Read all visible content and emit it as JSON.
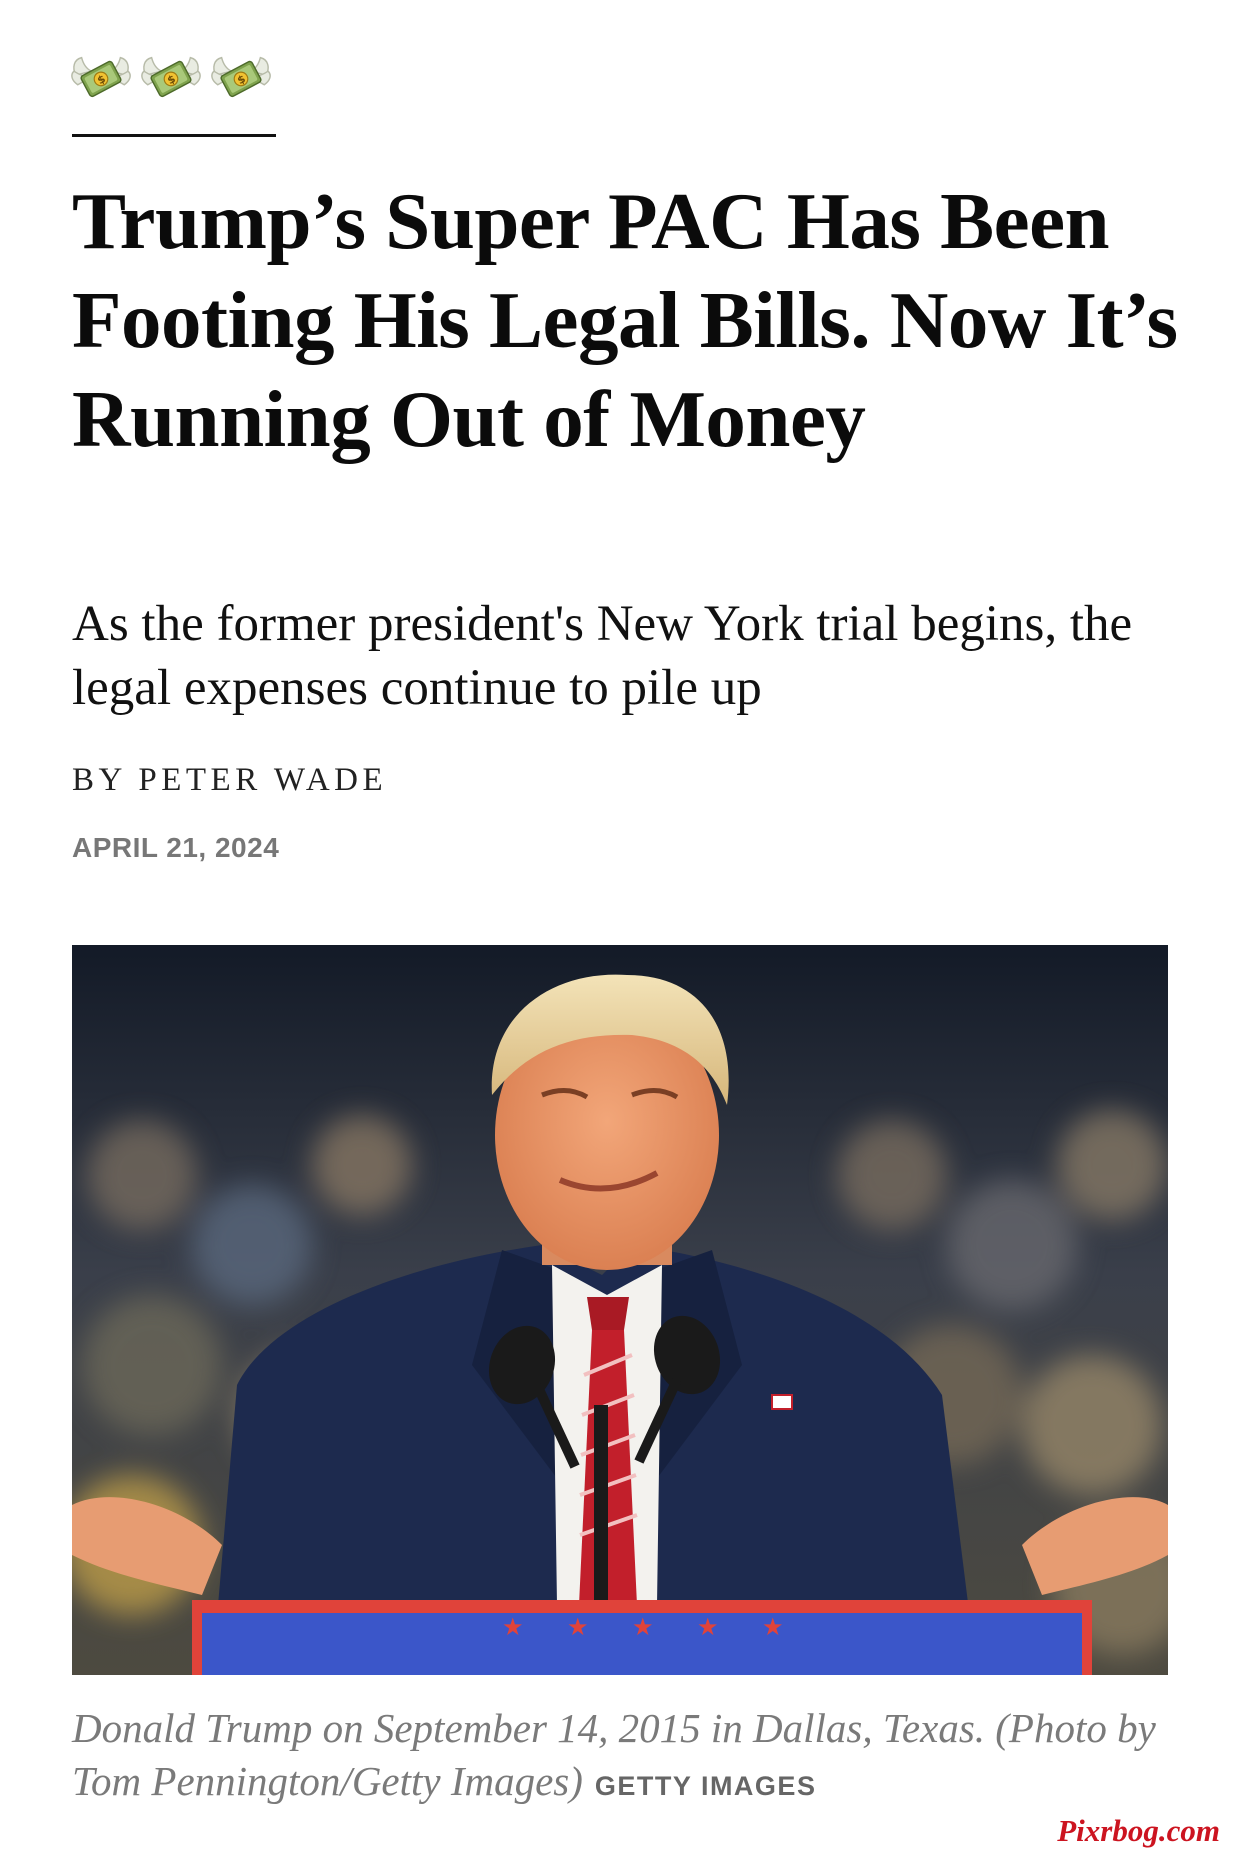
{
  "header": {
    "emoji_icons": [
      "money-with-wings-icon",
      "money-with-wings-icon",
      "money-with-wings-icon"
    ]
  },
  "article": {
    "headline": "Trump’s Super PAC Has Been Footing His Legal Bills. Now It’s Running Out of Money",
    "dek": "As the former president's New York trial begins, the legal expenses continue to pile up",
    "byline": "BY PETER WADE",
    "date": "APRIL 21, 2024"
  },
  "photo": {
    "caption": "Donald Trump on September 14, 2015 in Dallas, Texas. (Photo by Tom Pennington/Getty Images)",
    "credit": "GETTY IMAGES"
  },
  "watermark": "Pixrbog.com",
  "colors": {
    "text": "#111111",
    "meta_gray": "#777777",
    "caption_gray": "#7a7a7a",
    "watermark_red": "#cc1420",
    "podium_blue": "#3b56c9",
    "podium_red": "#e0433a",
    "suit_navy": "#1d2a4e"
  }
}
